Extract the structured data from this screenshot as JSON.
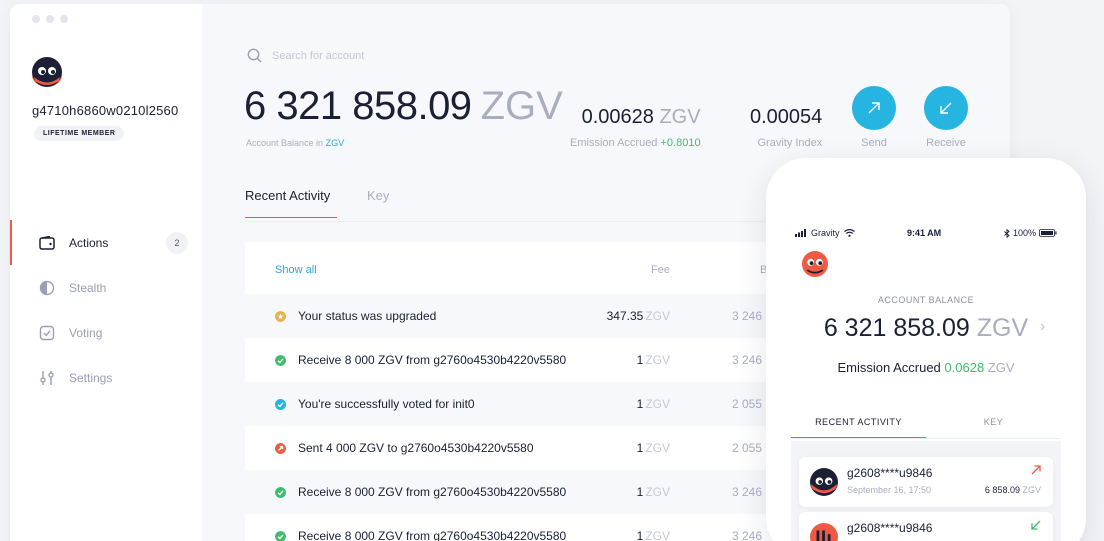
{
  "sidebar": {
    "account_id": "g4710h6860w0210l2560",
    "badge": "LIFETIME MEMBER",
    "items": [
      {
        "label": "Actions",
        "icon": "wallet-icon",
        "count": "2",
        "active": true
      },
      {
        "label": "Stealth",
        "icon": "stealth-icon"
      },
      {
        "label": "Voting",
        "icon": "checkbox-icon"
      },
      {
        "label": "Settings",
        "icon": "sliders-icon"
      }
    ]
  },
  "search": {
    "placeholder": "Search for account"
  },
  "balance": {
    "amount": "6 321 858.09",
    "unit": "ZGV",
    "caption": "Account Balance in",
    "caption_currency": "ZGV"
  },
  "stats": {
    "emission_value": "0.00628",
    "emission_unit": "ZGV",
    "emission_caption": "Emission Accrued",
    "emission_change": "+0.8010",
    "gravity_value": "0.00054",
    "gravity_caption": "Gravity Index"
  },
  "actions": {
    "send_label": "Send",
    "receive_label": "Receive"
  },
  "tabs": {
    "recent": "Recent Activity",
    "key": "Key"
  },
  "activity": {
    "show_all": "Show all",
    "col_fee": "Fee",
    "col_balance": "B",
    "rows": [
      {
        "desc": "Your status was upgraded",
        "fee": "347.35",
        "unit": "ZGV",
        "balance": "3 246",
        "status": "upgrade",
        "color": "#e8b04a"
      },
      {
        "desc": "Receive 8 000 ZGV from g2760o4530b4220v5580",
        "fee": "1",
        "unit": "ZGV",
        "balance": "3 246",
        "status": "received",
        "color": "#3bbd6a"
      },
      {
        "desc": "You're successfully voted for init0",
        "fee": "1",
        "unit": "ZGV",
        "balance": "2 055",
        "status": "voted",
        "color": "#26b5e1"
      },
      {
        "desc": "Sent 4 000 ZGV to g2760o4530b4220v5580",
        "fee": "1",
        "unit": "ZGV",
        "balance": "2 055",
        "status": "sent",
        "color": "#ee5a45"
      },
      {
        "desc": "Receive 8 000 ZGV from g2760o4530b4220v5580",
        "fee": "1",
        "unit": "ZGV",
        "balance": "3 246",
        "status": "received",
        "color": "#3bbd6a"
      },
      {
        "desc": "Receive 8 000 ZGV from g2760o4530b4220v5580",
        "fee": "1",
        "unit": "ZGV",
        "balance": "3 246",
        "status": "received",
        "color": "#3bbd6a"
      }
    ]
  },
  "phone": {
    "carrier": "Gravity",
    "time": "9:41 AM",
    "battery": "100%",
    "balance_caption": "ACCOUNT BALANCE",
    "balance": "6 321 858.09",
    "unit": "ZGV",
    "emission_label": "Emission Accrued",
    "emission_value": "0.0628",
    "tab_recent": "RECENT ACTIVITY",
    "tab_key": "KEY",
    "cards": [
      {
        "name": "g2608****u9846",
        "date": "September 16, 17:50",
        "amount": "6 858.09",
        "unit": "ZGV",
        "direction": "out"
      },
      {
        "name": "g2608****u9846",
        "direction": "in"
      }
    ]
  },
  "colors": {
    "accent": "#26b5e1",
    "brand_red": "#ee5a45",
    "positive": "#3bbd6a",
    "dark": "#1b2035"
  }
}
